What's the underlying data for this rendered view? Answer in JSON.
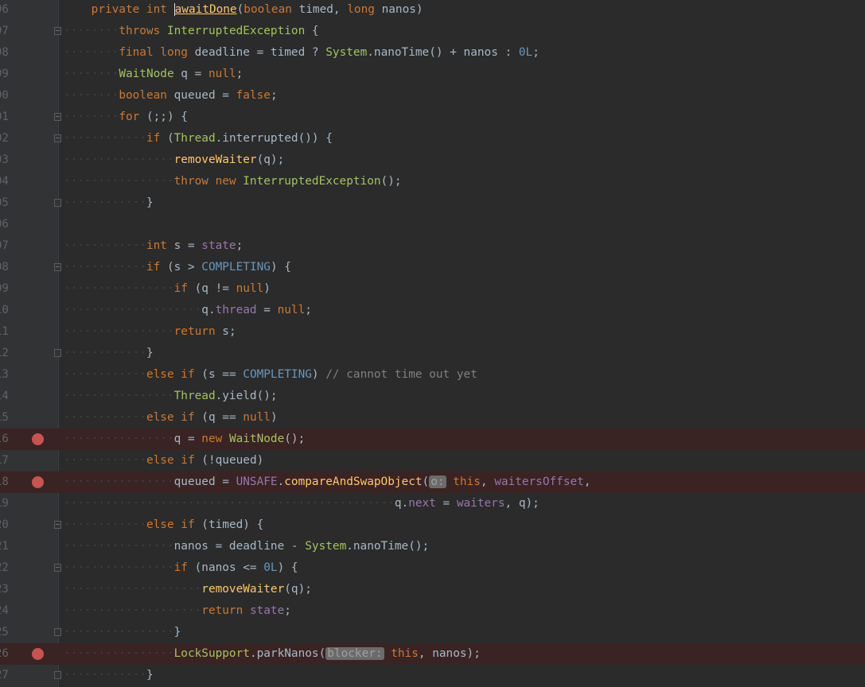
{
  "editor": {
    "lines": [
      {
        "num": "96",
        "bp": false,
        "fold": "none",
        "indent": "",
        "code": [
          [
            "kw",
            "private "
          ],
          [
            "kw",
            "int "
          ],
          [
            "fnu",
            "awaitDone"
          ],
          [
            "ph",
            "("
          ],
          [
            "kw",
            "boolean "
          ],
          [
            "ph",
            "timed, "
          ],
          [
            "kw",
            "long "
          ],
          [
            "ph",
            "nanos)"
          ]
        ]
      },
      {
        "num": "97",
        "bp": false,
        "fold": "open",
        "indent": "········",
        "code": [
          [
            "kw",
            "throws "
          ],
          [
            "cg",
            "InterruptedException "
          ],
          [
            "ph",
            "{"
          ]
        ]
      },
      {
        "num": "98",
        "bp": false,
        "fold": "none",
        "indent": "········",
        "code": [
          [
            "kw",
            "final "
          ],
          [
            "kw",
            "long "
          ],
          [
            "ph",
            "deadline = timed ? "
          ],
          [
            "cg",
            "System"
          ],
          [
            "ph",
            "."
          ],
          [
            "ph",
            "nanoTime() + nanos : "
          ],
          [
            "num",
            "0L"
          ],
          [
            "ph",
            ";"
          ]
        ]
      },
      {
        "num": "99",
        "bp": false,
        "fold": "none",
        "indent": "········",
        "code": [
          [
            "cg",
            "WaitNode "
          ],
          [
            "ph",
            "q = "
          ],
          [
            "kw",
            "null"
          ],
          [
            "ph",
            ";"
          ]
        ]
      },
      {
        "num": "00",
        "bp": false,
        "fold": "none",
        "indent": "········",
        "code": [
          [
            "kw",
            "boolean "
          ],
          [
            "ph",
            "queued = "
          ],
          [
            "kw",
            "false"
          ],
          [
            "ph",
            ";"
          ]
        ]
      },
      {
        "num": "01",
        "bp": false,
        "fold": "open",
        "indent": "········",
        "code": [
          [
            "kw",
            "for "
          ],
          [
            "ph",
            "(;;) {"
          ]
        ]
      },
      {
        "num": "02",
        "bp": false,
        "fold": "open",
        "indent": "············",
        "code": [
          [
            "kw",
            "if "
          ],
          [
            "ph",
            "("
          ],
          [
            "cg",
            "Thread"
          ],
          [
            "ph",
            ".interrupted()) {"
          ]
        ]
      },
      {
        "num": "03",
        "bp": false,
        "fold": "none",
        "indent": "················",
        "code": [
          [
            "fn",
            "removeWaiter"
          ],
          [
            "ph",
            "(q);"
          ]
        ]
      },
      {
        "num": "04",
        "bp": false,
        "fold": "none",
        "indent": "················",
        "code": [
          [
            "kw",
            "throw "
          ],
          [
            "kw",
            "new "
          ],
          [
            "cg",
            "InterruptedException"
          ],
          [
            "ph",
            "();"
          ]
        ]
      },
      {
        "num": "05",
        "bp": false,
        "fold": "close",
        "indent": "············",
        "code": [
          [
            "ph",
            "}"
          ]
        ]
      },
      {
        "num": "06",
        "bp": false,
        "fold": "none",
        "indent": "",
        "code": []
      },
      {
        "num": "07",
        "bp": false,
        "fold": "none",
        "indent": "············",
        "code": [
          [
            "kw",
            "int "
          ],
          [
            "ph",
            "s = "
          ],
          [
            "fld",
            "state"
          ],
          [
            "ph",
            ";"
          ]
        ]
      },
      {
        "num": "08",
        "bp": false,
        "fold": "open",
        "indent": "············",
        "code": [
          [
            "kw",
            "if "
          ],
          [
            "ph",
            "(s > "
          ],
          [
            "num",
            "COMPLETING"
          ],
          [
            "ph",
            ") {"
          ]
        ]
      },
      {
        "num": "09",
        "bp": false,
        "fold": "none",
        "indent": "················",
        "code": [
          [
            "kw",
            "if "
          ],
          [
            "ph",
            "(q != "
          ],
          [
            "kw",
            "null"
          ],
          [
            "ph",
            ")"
          ]
        ]
      },
      {
        "num": "10",
        "bp": false,
        "fold": "none",
        "indent": "····················",
        "code": [
          [
            "ph",
            "q."
          ],
          [
            "fld",
            "thread "
          ],
          [
            "ph",
            "= "
          ],
          [
            "kw",
            "null"
          ],
          [
            "ph",
            ";"
          ]
        ]
      },
      {
        "num": "11",
        "bp": false,
        "fold": "none",
        "indent": "················",
        "code": [
          [
            "kw",
            "return "
          ],
          [
            "ph",
            "s;"
          ]
        ]
      },
      {
        "num": "12",
        "bp": false,
        "fold": "close",
        "indent": "············",
        "code": [
          [
            "ph",
            "}"
          ]
        ]
      },
      {
        "num": "13",
        "bp": false,
        "fold": "none",
        "indent": "············",
        "code": [
          [
            "kw",
            "else "
          ],
          [
            "kw",
            "if "
          ],
          [
            "ph",
            "(s == "
          ],
          [
            "num",
            "COMPLETING"
          ],
          [
            "ph",
            ") "
          ],
          [
            "cm",
            "// cannot time out yet"
          ]
        ]
      },
      {
        "num": "14",
        "bp": false,
        "fold": "none",
        "indent": "················",
        "code": [
          [
            "cg",
            "Thread"
          ],
          [
            "ph",
            ".yield();"
          ]
        ]
      },
      {
        "num": "15",
        "bp": false,
        "fold": "none",
        "indent": "············",
        "code": [
          [
            "kw",
            "else "
          ],
          [
            "kw",
            "if "
          ],
          [
            "ph",
            "(q == "
          ],
          [
            "kw",
            "null"
          ],
          [
            "ph",
            ")"
          ]
        ]
      },
      {
        "num": "16",
        "bp": true,
        "fold": "none",
        "indent": "················",
        "code": [
          [
            "ph",
            "q = "
          ],
          [
            "kw",
            "new "
          ],
          [
            "cg",
            "WaitNode"
          ],
          [
            "ph",
            "();"
          ]
        ]
      },
      {
        "num": "17",
        "bp": false,
        "fold": "none",
        "indent": "············",
        "code": [
          [
            "kw",
            "else "
          ],
          [
            "kw",
            "if "
          ],
          [
            "ph",
            "(!queued)"
          ]
        ]
      },
      {
        "num": "18",
        "bp": true,
        "fold": "none",
        "indent": "················",
        "code": [
          [
            "ph",
            "queued = "
          ],
          [
            "fld",
            "UNSAFE"
          ],
          [
            "ph",
            "."
          ],
          [
            "fn",
            "compareAndSwapObject"
          ],
          [
            "ph",
            "("
          ],
          [
            "hint",
            "o:"
          ],
          [
            "ph",
            " "
          ],
          [
            "kw",
            "this"
          ],
          [
            "ph",
            ", "
          ],
          [
            "fld",
            "waitersOffset"
          ],
          [
            "ph",
            ","
          ]
        ]
      },
      {
        "num": "19",
        "bp": false,
        "fold": "none",
        "indent": "················································",
        "code": [
          [
            "ph",
            "q."
          ],
          [
            "fld",
            "next "
          ],
          [
            "ph",
            "= "
          ],
          [
            "fld",
            "waiters"
          ],
          [
            "ph",
            ", q);"
          ]
        ]
      },
      {
        "num": "20",
        "bp": false,
        "fold": "open",
        "indent": "············",
        "code": [
          [
            "kw",
            "else "
          ],
          [
            "kw",
            "if "
          ],
          [
            "ph",
            "(timed) {"
          ]
        ]
      },
      {
        "num": "21",
        "bp": false,
        "fold": "none",
        "indent": "················",
        "code": [
          [
            "ph",
            "nanos = deadline - "
          ],
          [
            "cg",
            "System"
          ],
          [
            "ph",
            ".nanoTime();"
          ]
        ]
      },
      {
        "num": "22",
        "bp": false,
        "fold": "open",
        "indent": "················",
        "code": [
          [
            "kw",
            "if "
          ],
          [
            "ph",
            "(nanos <= "
          ],
          [
            "num",
            "0L"
          ],
          [
            "ph",
            ") {"
          ]
        ]
      },
      {
        "num": "23",
        "bp": false,
        "fold": "none",
        "indent": "····················",
        "code": [
          [
            "fn",
            "removeWaiter"
          ],
          [
            "ph",
            "(q);"
          ]
        ]
      },
      {
        "num": "24",
        "bp": false,
        "fold": "none",
        "indent": "····················",
        "code": [
          [
            "kw",
            "return "
          ],
          [
            "fld",
            "state"
          ],
          [
            "ph",
            ";"
          ]
        ]
      },
      {
        "num": "25",
        "bp": false,
        "fold": "close",
        "indent": "················",
        "code": [
          [
            "ph",
            "}"
          ]
        ]
      },
      {
        "num": "26",
        "bp": true,
        "fold": "none",
        "indent": "················",
        "code": [
          [
            "cg",
            "LockSupport"
          ],
          [
            "ph",
            ".parkNanos("
          ],
          [
            "hint",
            "blocker:"
          ],
          [
            "ph",
            " "
          ],
          [
            "kw",
            "this"
          ],
          [
            "ph",
            ", nanos);"
          ]
        ]
      },
      {
        "num": "27",
        "bp": false,
        "fold": "close",
        "indent": "············",
        "code": [
          [
            "ph",
            "}"
          ]
        ]
      }
    ]
  }
}
